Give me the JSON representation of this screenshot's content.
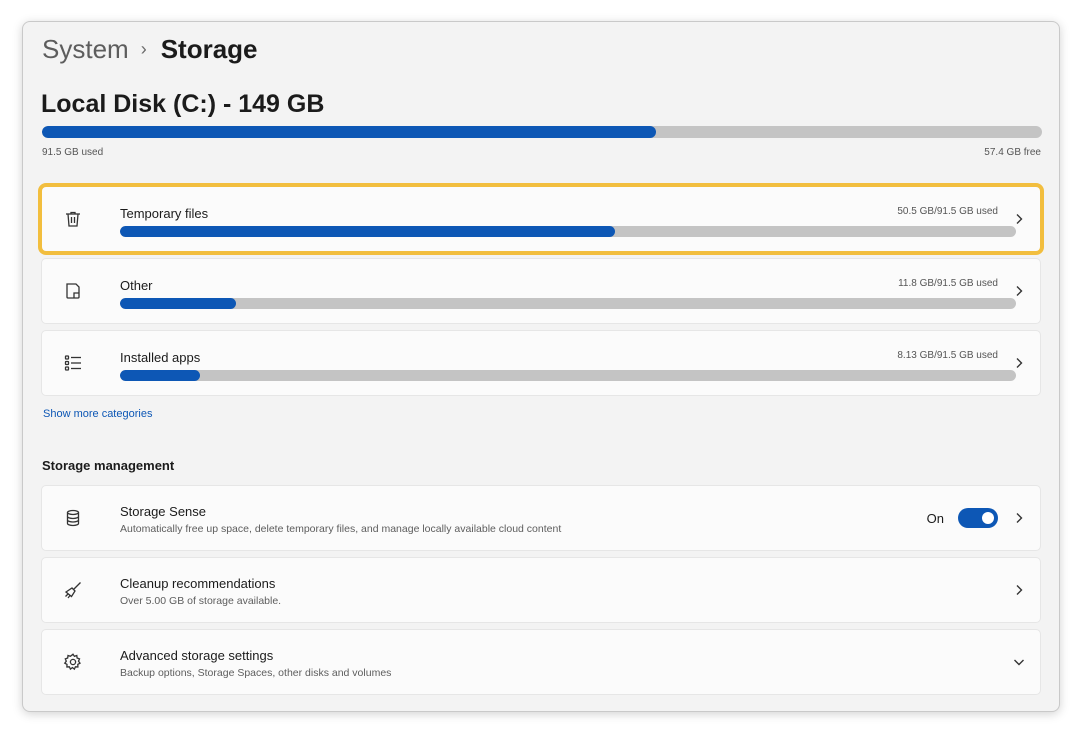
{
  "breadcrumb": {
    "parent": "System",
    "current": "Storage"
  },
  "disk": {
    "title": "Local Disk (C:) - 149 GB",
    "used_label": "91.5 GB used",
    "free_label": "57.4 GB free",
    "used_fraction": 0.614
  },
  "categories": [
    {
      "label": "Temporary files",
      "usage": "50.5 GB/91.5 GB used",
      "fraction": 0.552,
      "icon": "trash-icon",
      "highlighted": true
    },
    {
      "label": "Other",
      "usage": "11.8 GB/91.5 GB used",
      "fraction": 0.129,
      "icon": "document-icon",
      "highlighted": false
    },
    {
      "label": "Installed apps",
      "usage": "8.13 GB/91.5 GB used",
      "fraction": 0.089,
      "icon": "list-icon",
      "highlighted": false
    }
  ],
  "show_more_label": "Show more categories",
  "management": {
    "title": "Storage management",
    "items": [
      {
        "title": "Storage Sense",
        "desc": "Automatically free up space, delete temporary files, and manage locally available cloud content",
        "toggle_label": "On",
        "toggle_on": true,
        "icon": "database-icon",
        "trail": "chevron-right-icon"
      },
      {
        "title": "Cleanup recommendations",
        "desc": "Over 5.00 GB of storage available.",
        "icon": "broom-icon",
        "trail": "chevron-right-icon"
      },
      {
        "title": "Advanced storage settings",
        "desc": "Backup options, Storage Spaces, other disks and volumes",
        "icon": "gear-icon",
        "trail": "chevron-down-icon"
      }
    ]
  },
  "colors": {
    "accent": "#0d57b5",
    "highlight": "#f2be3e",
    "bar_track": "#c4c4c4"
  }
}
